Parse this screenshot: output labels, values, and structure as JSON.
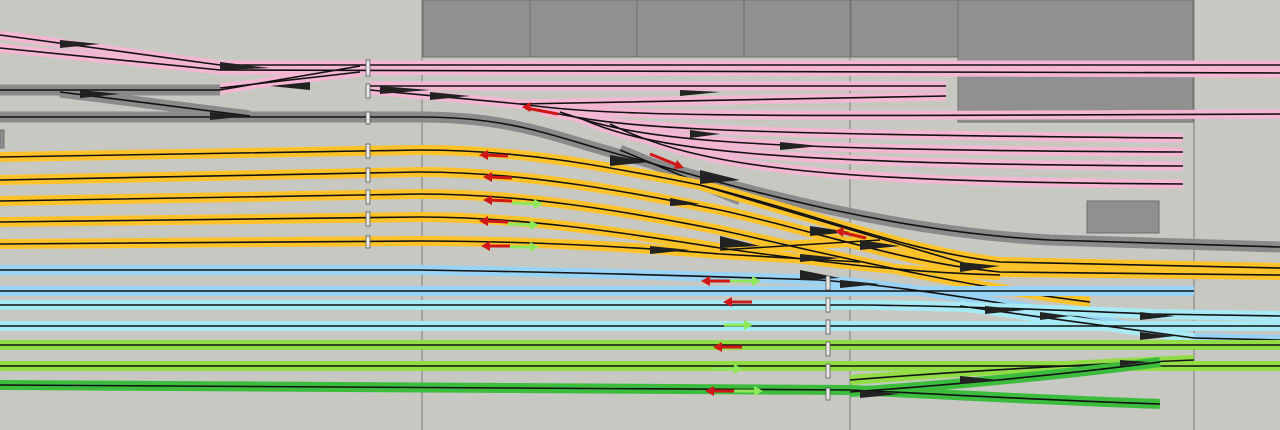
{
  "palette": {
    "background": "#c8c8c3",
    "grid_line": "#7a7a78",
    "building": "#909090",
    "building_edge": "#6e6e6e",
    "pink_track": "#f4b6d2",
    "gray_track": "#8a8a8a",
    "yellow_track": "#ffc228",
    "blue_track": "#98d2f4",
    "cyan_track": "#a6eaf6",
    "light_green_track": "#92dc46",
    "green_track": "#3cbc3c",
    "rail": "#111111",
    "signal_red": "#d01818",
    "signal_green": "#8ee85a",
    "marker": "#e8e8e8"
  },
  "track_groups": [
    {
      "name": "pink",
      "track_count": 7
    },
    {
      "name": "gray",
      "track_count": 2
    },
    {
      "name": "yellow",
      "track_count": 5
    },
    {
      "name": "blue",
      "track_count": 2
    },
    {
      "name": "cyan",
      "track_count": 2
    },
    {
      "name": "light-green",
      "track_count": 2
    },
    {
      "name": "green",
      "track_count": 2
    }
  ],
  "icons": {
    "signal_left": "arrow-left",
    "signal_right": "arrow-right",
    "marker": "rectangle"
  }
}
